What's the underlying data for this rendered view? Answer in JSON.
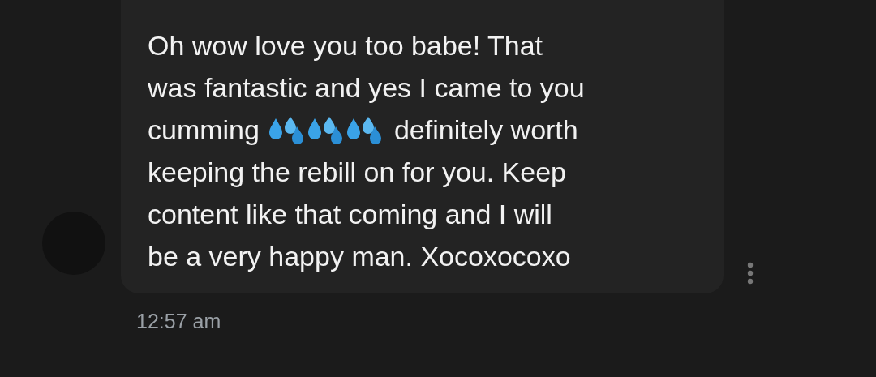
{
  "message": {
    "lines": [
      [
        {
          "kind": "text",
          "text": "Oh wow love you too babe! That"
        }
      ],
      [
        {
          "kind": "text",
          "text": "was fantastic and yes I came to you"
        }
      ],
      [
        {
          "kind": "text",
          "text": "cumming"
        },
        {
          "kind": "droplets"
        },
        {
          "kind": "droplets"
        },
        {
          "kind": "droplets"
        },
        {
          "kind": "text",
          "text": "definitely worth"
        }
      ],
      [
        {
          "kind": "text",
          "text": "keeping the rebill on for you. Keep"
        }
      ],
      [
        {
          "kind": "text",
          "text": "content like that coming and I will"
        }
      ],
      [
        {
          "kind": "text",
          "text": "be a very happy man. Xocoxocoxo"
        }
      ]
    ],
    "time": "12:57 am"
  }
}
